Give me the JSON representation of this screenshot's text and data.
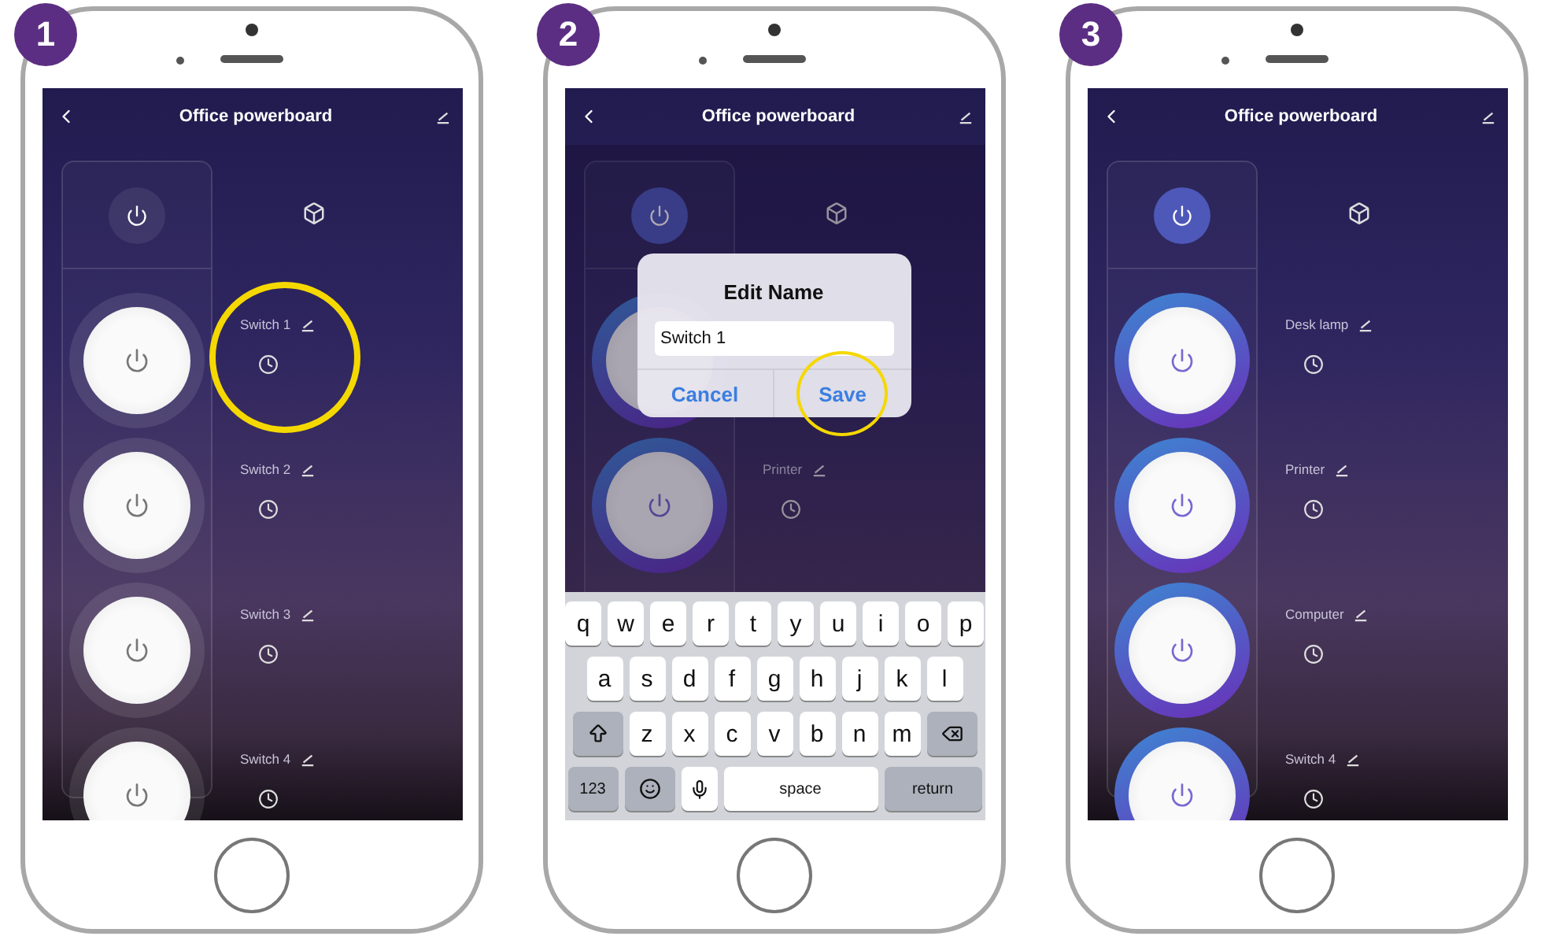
{
  "steps": [
    {
      "number": "1",
      "screen": {
        "title": "Office powerboard",
        "master_on": false,
        "switches": [
          {
            "label": "Switch 1",
            "on": false,
            "highlighted": true
          },
          {
            "label": "Switch 2",
            "on": false,
            "highlighted": false
          },
          {
            "label": "Switch 3",
            "on": false,
            "highlighted": false
          },
          {
            "label": "Switch 4",
            "on": false,
            "highlighted": false
          }
        ]
      }
    },
    {
      "number": "2",
      "screen": {
        "title": "Office powerboard",
        "master_on": true,
        "switches": [
          {
            "on": true,
            "highlighted": false
          },
          {
            "label": "Printer",
            "on": true,
            "highlighted": false
          }
        ],
        "dialog": {
          "title": "Edit Name",
          "value": "Switch 1",
          "cancel": "Cancel",
          "save": "Save",
          "save_highlighted": true
        },
        "keyboard": {
          "rows": [
            {
              "keys": [
                {
                  "kind": "letter",
                  "label": "q"
                },
                {
                  "kind": "letter",
                  "label": "w"
                },
                {
                  "kind": "letter",
                  "label": "e"
                },
                {
                  "kind": "letter",
                  "label": "r"
                },
                {
                  "kind": "letter",
                  "label": "t"
                },
                {
                  "kind": "letter",
                  "label": "y"
                },
                {
                  "kind": "letter",
                  "label": "u"
                },
                {
                  "kind": "letter",
                  "label": "i"
                },
                {
                  "kind": "letter",
                  "label": "o"
                },
                {
                  "kind": "letter",
                  "label": "p"
                }
              ]
            },
            {
              "keys": [
                {
                  "kind": "letter",
                  "label": "a"
                },
                {
                  "kind": "letter",
                  "label": "s"
                },
                {
                  "kind": "letter",
                  "label": "d"
                },
                {
                  "kind": "letter",
                  "label": "f"
                },
                {
                  "kind": "letter",
                  "label": "g"
                },
                {
                  "kind": "letter",
                  "label": "h"
                },
                {
                  "kind": "letter",
                  "label": "j"
                },
                {
                  "kind": "letter",
                  "label": "k"
                },
                {
                  "kind": "letter",
                  "label": "l"
                }
              ]
            },
            {
              "keys": [
                {
                  "kind": "shift"
                },
                {
                  "kind": "letter",
                  "label": "z"
                },
                {
                  "kind": "letter",
                  "label": "x"
                },
                {
                  "kind": "letter",
                  "label": "c"
                },
                {
                  "kind": "letter",
                  "label": "v"
                },
                {
                  "kind": "letter",
                  "label": "b"
                },
                {
                  "kind": "letter",
                  "label": "n"
                },
                {
                  "kind": "letter",
                  "label": "m"
                },
                {
                  "kind": "backspace"
                }
              ]
            },
            {
              "keys": [
                {
                  "kind": "numbers",
                  "label": "123"
                },
                {
                  "kind": "emoji"
                },
                {
                  "kind": "mic"
                },
                {
                  "kind": "space",
                  "label": "space"
                },
                {
                  "kind": "return",
                  "label": "return"
                }
              ]
            }
          ]
        }
      }
    },
    {
      "number": "3",
      "screen": {
        "title": "Office powerboard",
        "master_on": true,
        "switches": [
          {
            "label": "Desk lamp",
            "on": true,
            "highlighted": false
          },
          {
            "label": "Printer",
            "on": true,
            "highlighted": false
          },
          {
            "label": "Computer",
            "on": true,
            "highlighted": false
          },
          {
            "label": "Switch 4",
            "on": true,
            "highlighted": false
          }
        ]
      }
    }
  ]
}
